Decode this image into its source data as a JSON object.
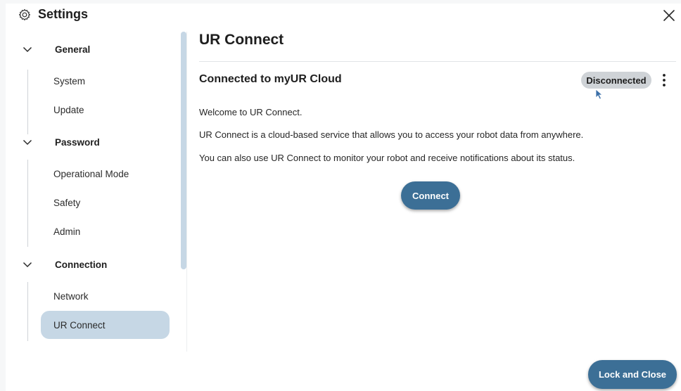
{
  "header": {
    "icon": "gear-icon",
    "title": "Settings",
    "close_icon": "close-icon"
  },
  "sidebar": {
    "sections": [
      {
        "label": "General",
        "icon": "chevron-down-icon",
        "items": [
          "System",
          "Update"
        ]
      },
      {
        "label": "Password",
        "icon": "chevron-down-icon",
        "items": [
          "Operational Mode",
          "Safety",
          "Admin"
        ]
      },
      {
        "label": "Connection",
        "icon": "chevron-down-icon",
        "items": [
          "Network",
          "UR Connect"
        ]
      }
    ],
    "active_item": "UR Connect"
  },
  "main": {
    "title": "UR Connect",
    "subtitle": "Connected to myUR Cloud",
    "status_badge": "Disconnected",
    "menu_icon": "more-vertical-icon",
    "paragraphs": [
      "Welcome to UR Connect.",
      "UR Connect is a cloud-based service that allows you to access your robot data from anywhere.",
      "You can also use UR Connect to monitor your robot and receive notifications about its status."
    ],
    "connect_button": "Connect"
  },
  "footer": {
    "lock_button": "Lock and Close"
  },
  "colors": {
    "accent": "#3c6f96",
    "active_bg": "#c6d7e5",
    "badge_bg": "#cfd3d7"
  }
}
